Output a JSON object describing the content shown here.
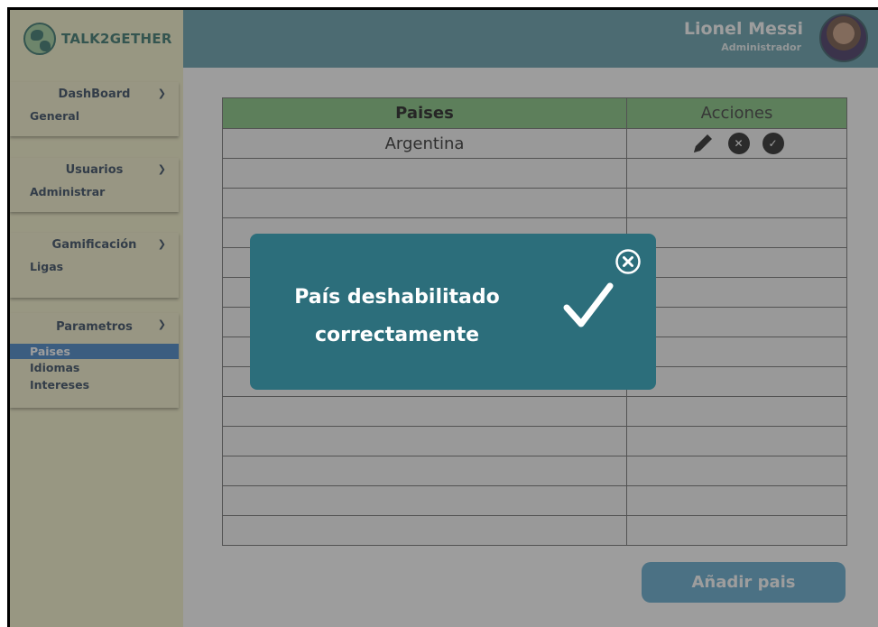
{
  "app": {
    "brand": "TALK2GETHER"
  },
  "user": {
    "name": "Lionel Messi",
    "role": "Administrador"
  },
  "sidebar": {
    "sections": [
      {
        "title": "DashBoard",
        "items": [
          "General"
        ]
      },
      {
        "title": "Usuarios",
        "items": [
          "Administrar"
        ]
      },
      {
        "title": "Gamificación",
        "items": [
          "Ligas"
        ]
      },
      {
        "title": "Parametros",
        "items": [
          "Paises",
          "Idiomas",
          "Intereses"
        ],
        "active_item": "Paises"
      }
    ]
  },
  "table": {
    "headers": {
      "country": "Paises",
      "actions": "Acciones"
    },
    "rows": [
      {
        "country": "Argentina"
      }
    ]
  },
  "add_button": {
    "label": "Añadir pais"
  },
  "modal": {
    "message_line1": "País deshabilitado",
    "message_line2": "correctamente"
  },
  "colors": {
    "sidebar_bg": "#f5f2c8",
    "topbar_bg": "#5d9aa8",
    "table_header_bg": "#7ec27a",
    "modal_bg": "#2c6e7b",
    "button_bg": "#5aa6cc",
    "active_item_bg": "#3b7fc4"
  },
  "icons": [
    "globe-logo-icon",
    "chevron-down-icon",
    "pencil-icon",
    "x-circle-icon",
    "check-circle-icon",
    "close-icon",
    "checkmark-icon"
  ]
}
